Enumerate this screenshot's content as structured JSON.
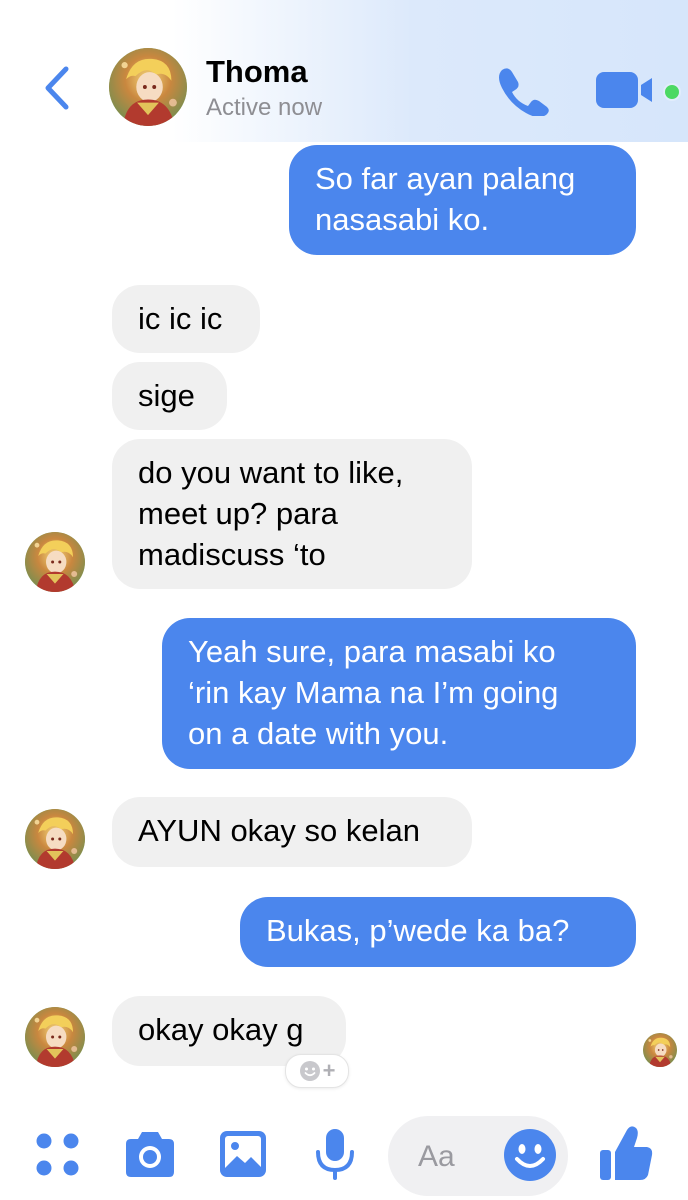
{
  "header": {
    "contact_name": "Thoma",
    "status": "Active now",
    "online": true
  },
  "messages": [
    {
      "side": "out",
      "text": "So far ayan palang\nnasasabi ko."
    },
    {
      "side": "in",
      "text": "ic ic ic"
    },
    {
      "side": "in",
      "text": "sige"
    },
    {
      "side": "in",
      "text": "do you want to like,\nmeet up? para\nmadiscuss ‘to"
    },
    {
      "side": "out",
      "text": "Yeah sure, para masabi ko\n‘rin kay Mama na I’m going\non a date with you."
    },
    {
      "side": "in",
      "text": "AYUN okay so kelan"
    },
    {
      "side": "out",
      "text": "Bukas, p’wede ka ba?"
    },
    {
      "side": "in",
      "text": "okay okay g"
    }
  ],
  "reaction_add": {
    "label": "+"
  },
  "composer": {
    "placeholder": "Aa"
  },
  "icons": {
    "back": "chevron-left-icon",
    "call": "phone-icon",
    "video": "video-camera-icon",
    "apps": "four-dots-icon",
    "camera": "camera-icon",
    "gallery": "image-icon",
    "mic": "microphone-icon",
    "emoji": "smiley-icon",
    "like": "thumbs-up-icon"
  },
  "colors": {
    "accent": "#4b86ed",
    "outgoing_bubble": "#4b86ed",
    "incoming_bubble": "#f0f0f0",
    "online": "#4cd964"
  }
}
